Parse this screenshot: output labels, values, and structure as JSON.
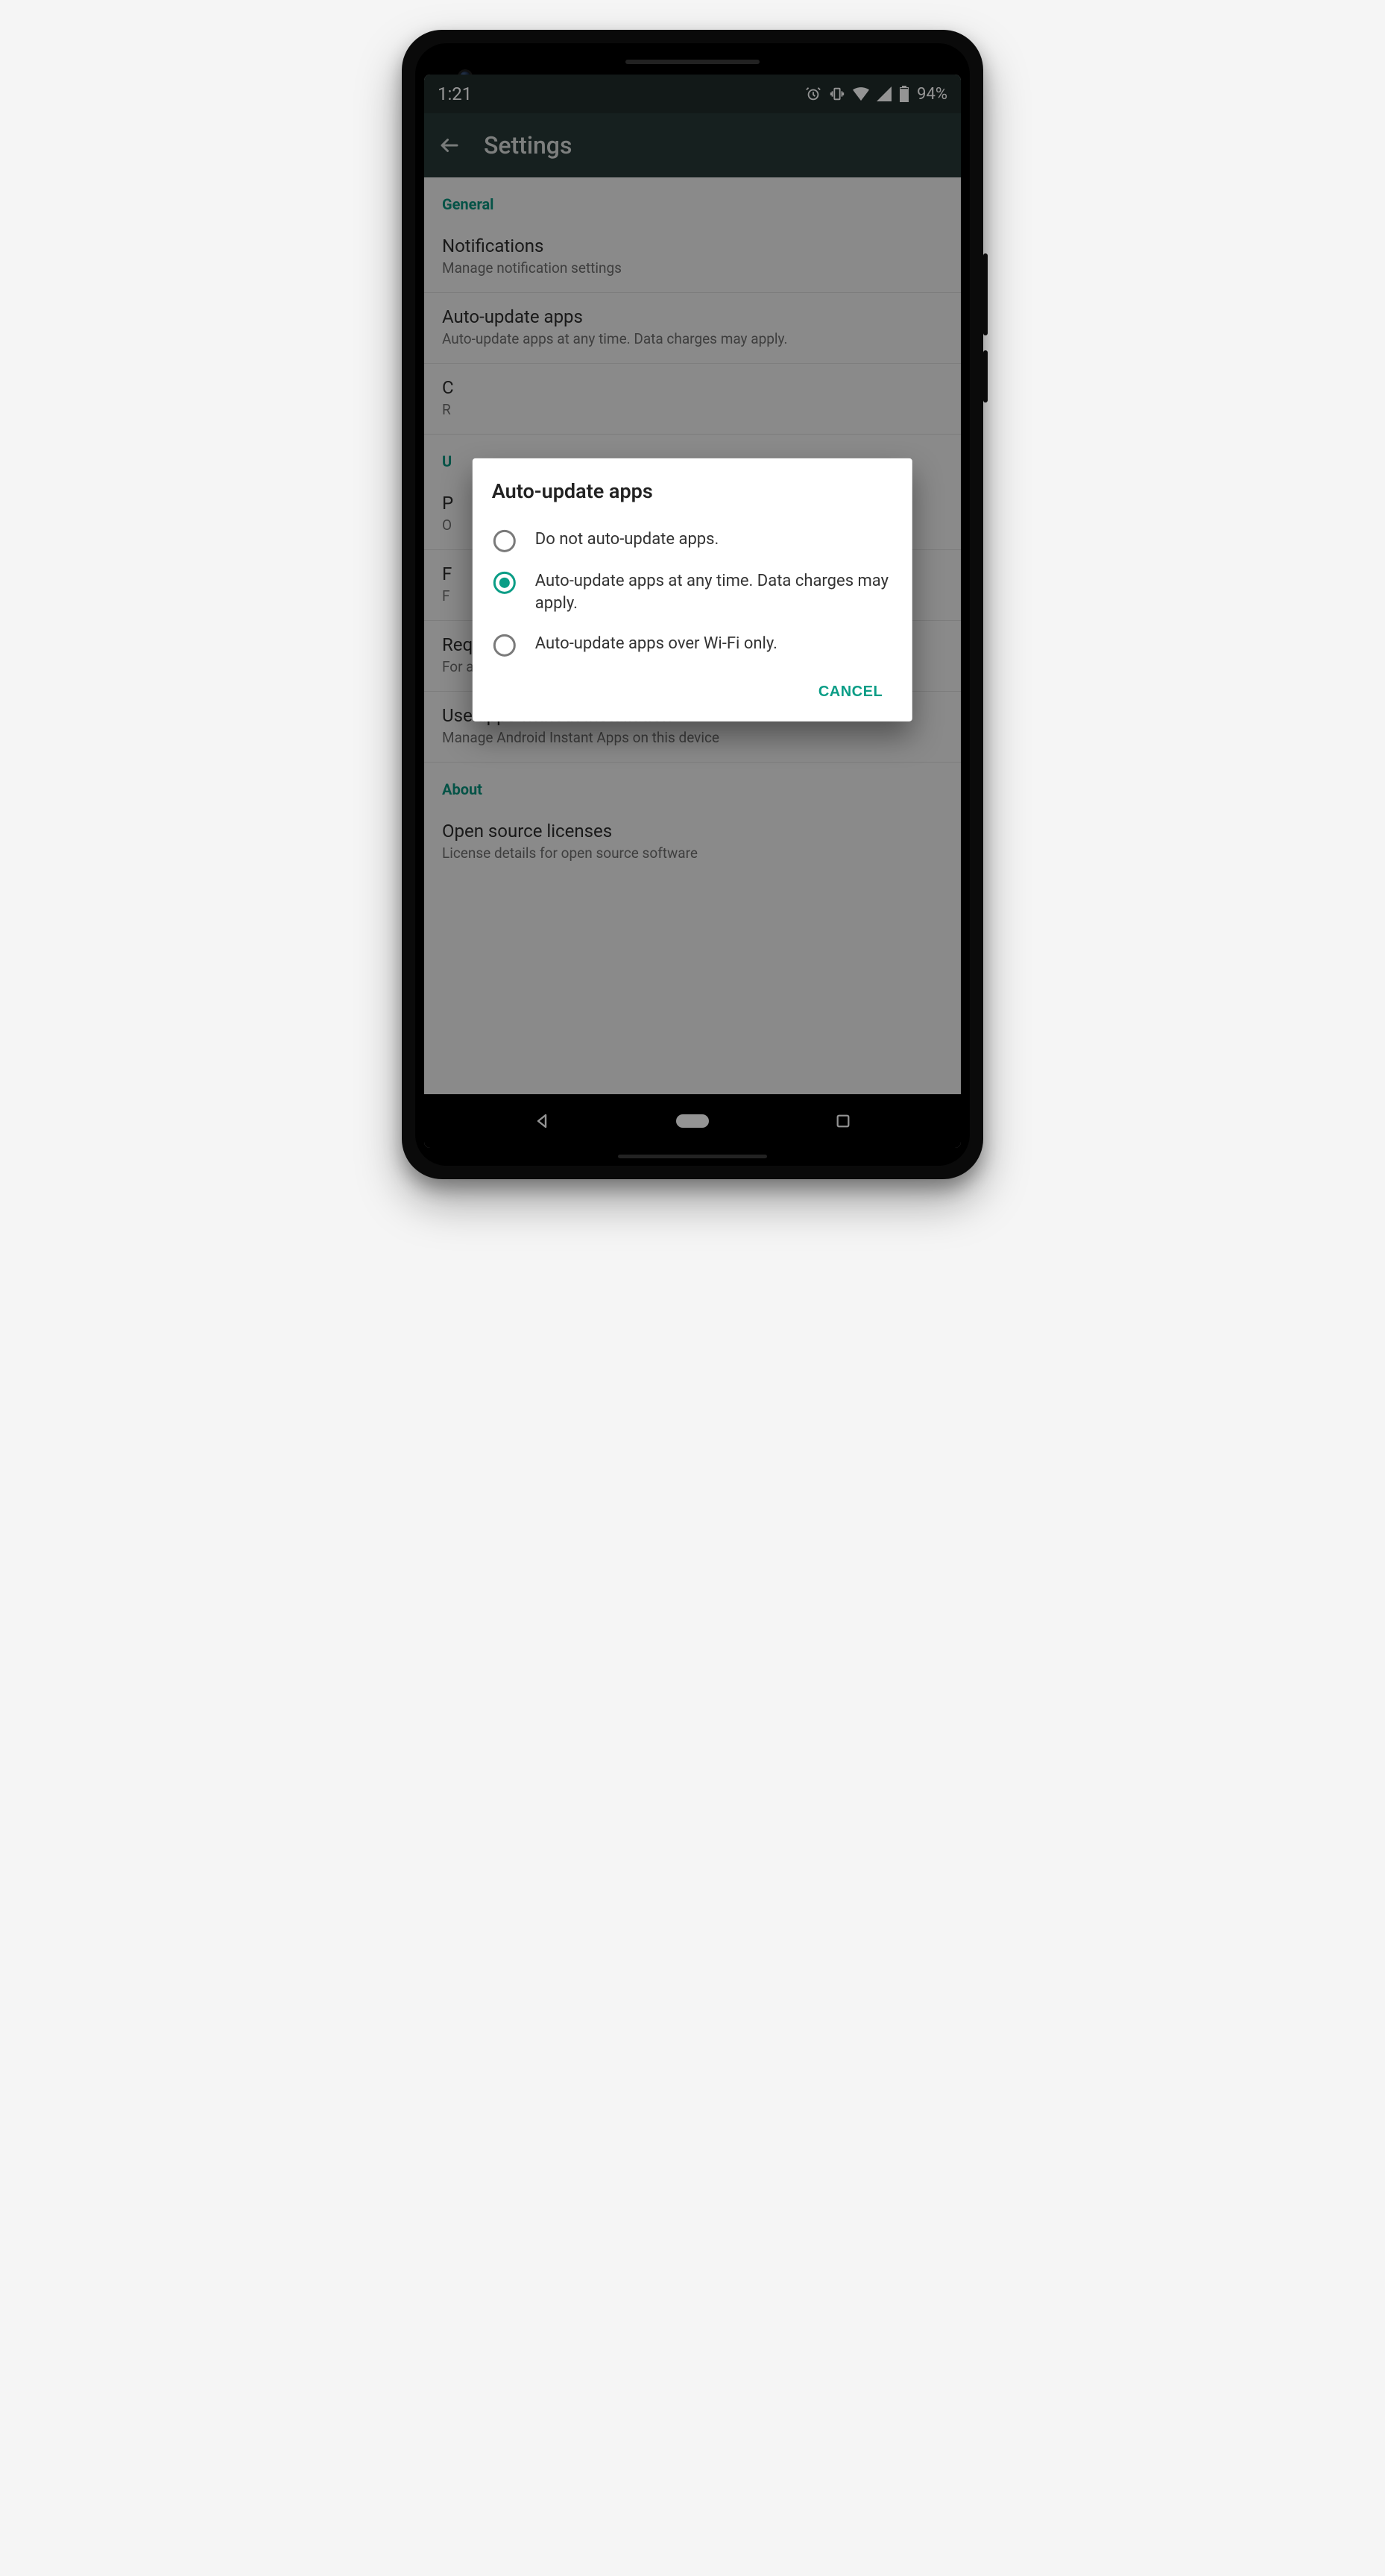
{
  "status": {
    "time": "1:21",
    "battery": "94%"
  },
  "appbar": {
    "title": "Settings"
  },
  "sections": [
    {
      "header": "General",
      "items": [
        {
          "title": "Notifications",
          "sub": "Manage notification settings"
        },
        {
          "title": "Auto-update apps",
          "sub": "Auto-update apps at any time. Data charges may apply."
        },
        {
          "title": "C",
          "sub": "R"
        }
      ]
    },
    {
      "header": "U",
      "items": [
        {
          "title": "P",
          "sub": "O"
        },
        {
          "title": "F",
          "sub": "F"
        },
        {
          "title": "Require authentication for purchases",
          "sub": "For all purchases through Google Play on this device"
        },
        {
          "title": "Use apps without installation",
          "sub": "Manage Android Instant Apps on this device"
        }
      ]
    },
    {
      "header": "About",
      "items": [
        {
          "title": "Open source licenses",
          "sub": "License details for open source software"
        }
      ]
    }
  ],
  "dialog": {
    "title": "Auto-update apps",
    "options": [
      {
        "label": "Do not auto-update apps.",
        "selected": false
      },
      {
        "label": "Auto-update apps at any time. Data charges may apply.",
        "selected": true
      },
      {
        "label": "Auto-update apps over Wi-Fi only.",
        "selected": false
      }
    ],
    "cancel": "CANCEL"
  },
  "colors": {
    "accent": "#0a9d86"
  }
}
